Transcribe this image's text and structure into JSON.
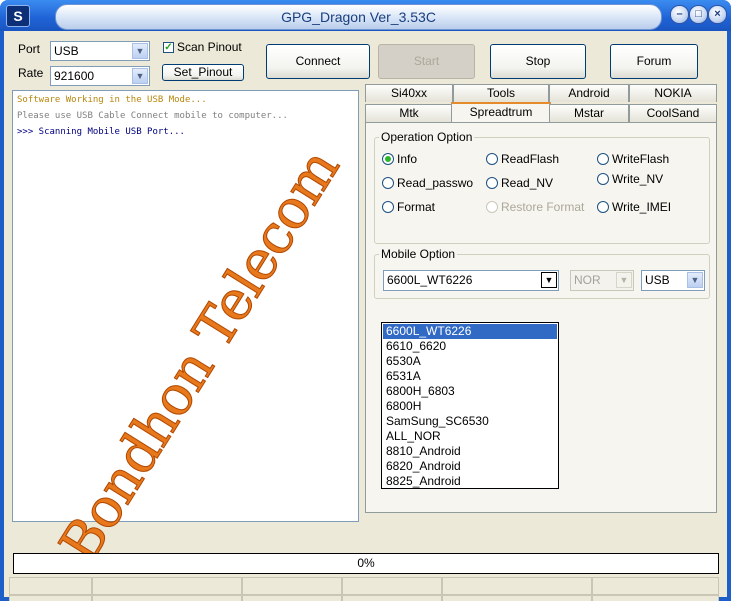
{
  "window": {
    "title": "GPG_Dragon  Ver_3.53C",
    "icon_label": "S"
  },
  "connection": {
    "port_label": "Port",
    "port_value": "USB",
    "rate_label": "Rate",
    "rate_value": "921600",
    "scan_pinout_label": "Scan Pinout",
    "scan_pinout_checked": true,
    "set_pinout_label": "Set_Pinout"
  },
  "toolbar": {
    "connect": "Connect",
    "start": "Start",
    "stop": "Stop",
    "forum": "Forum"
  },
  "log": {
    "lines": [
      {
        "text": "   Software Working in the USB Mode...",
        "color": "#b8860b"
      },
      {
        "text": "   Please use USB Cable Connect mobile to computer...",
        "color": "#808080"
      },
      {
        "text": ">>> Scanning Mobile USB Port...",
        "color": "#000080"
      }
    ]
  },
  "watermark": "Bondhon Telecom",
  "tabs": {
    "row1": [
      "Si40xx",
      "Tools",
      "Android",
      "NOKIA"
    ],
    "row2": [
      "Mtk",
      "Spreadtrum",
      "Mstar",
      "CoolSand"
    ],
    "active": "Spreadtrum"
  },
  "operation": {
    "title": "Operation Option",
    "options": [
      {
        "label": "Info",
        "checked": true,
        "disabled": false
      },
      {
        "label": "ReadFlash",
        "checked": false,
        "disabled": false
      },
      {
        "label": "WriteFlash",
        "checked": false,
        "disabled": false
      },
      {
        "label": "Read_passwo",
        "checked": false,
        "disabled": false
      },
      {
        "label": "Read_NV",
        "checked": false,
        "disabled": false
      },
      {
        "label": "Write_NV",
        "checked": false,
        "disabled": false
      },
      {
        "label": "Format",
        "checked": false,
        "disabled": false
      },
      {
        "label": "Restore Format",
        "checked": false,
        "disabled": true
      },
      {
        "label": "Write_IMEI",
        "checked": false,
        "disabled": false
      }
    ]
  },
  "mobile": {
    "title": "Mobile Option",
    "model_value": "6600L_WT6226",
    "memory_value": "NOR",
    "interface_value": "USB",
    "model_options": [
      "6600L_WT6226",
      "6610_6620",
      "6530A",
      "6531A",
      "6800H_6803",
      "6800H",
      "SamSung_SC6530",
      "ALL_NOR",
      "8810_Android",
      "6820_Android",
      "8825_Android"
    ]
  },
  "progress": {
    "text": "0%",
    "value": 0
  }
}
